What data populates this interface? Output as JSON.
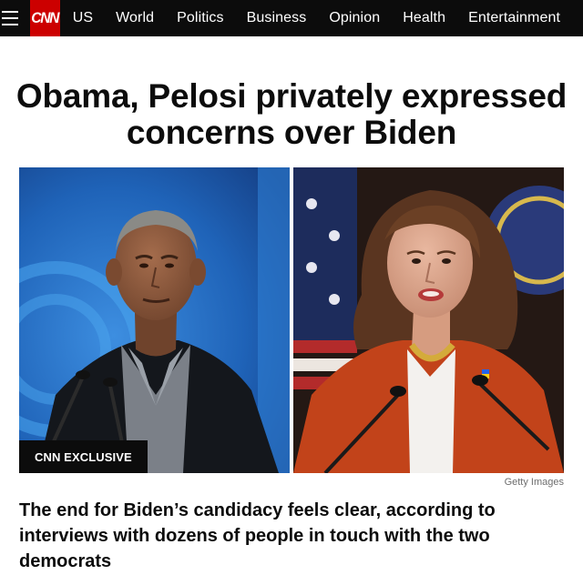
{
  "nav": {
    "logo_text": "CNN",
    "items": [
      "US",
      "World",
      "Politics",
      "Business",
      "Opinion",
      "Health",
      "Entertainment"
    ]
  },
  "headline": "Obama, Pelosi privately expressed concerns over Biden",
  "image": {
    "badge": "CNN EXCLUSIVE",
    "credit": "Getty Images"
  },
  "subhead": "The end for Biden’s candidacy feels clear, according to interviews with dozens of people in touch with the two democrats",
  "colors": {
    "nav_bg": "#0c0c0c",
    "brand_red": "#cc0000",
    "text": "#0c0c0c"
  },
  "icons": [
    "menu-icon"
  ]
}
